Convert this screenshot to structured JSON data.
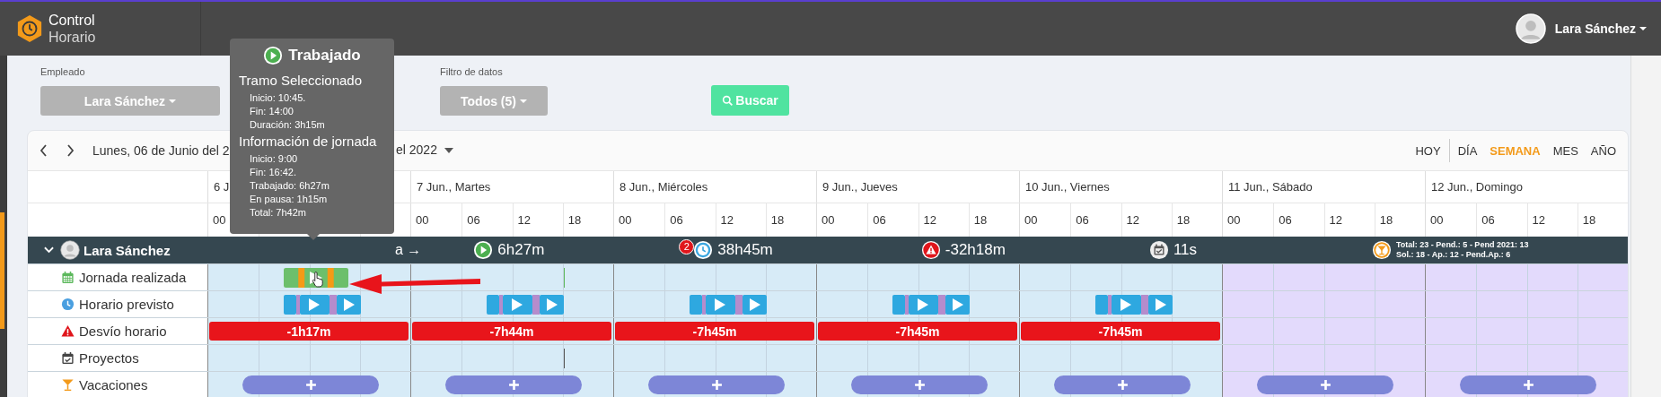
{
  "app": {
    "title_line_1": "Control",
    "title_line_2": "Horario"
  },
  "user": {
    "name": "Lara Sánchez"
  },
  "filters": [
    {
      "label": "Empleado",
      "value": "Lara Sánchez"
    },
    {
      "label": "Filtro de datos",
      "value": "Todos (5)"
    }
  ],
  "search_button": "Buscar",
  "toolbar": {
    "date_range_start": "Lunes, 06 de Junio del 2",
    "date_range_end": "el 2022",
    "views": [
      {
        "label": "HOY",
        "selected": false
      },
      {
        "label": "DÍA",
        "selected": false
      },
      {
        "label": "SEMANA",
        "selected": true
      },
      {
        "label": "MES",
        "selected": false
      },
      {
        "label": "AÑO",
        "selected": false
      }
    ]
  },
  "days": [
    {
      "label": "6 J",
      "kind": "weekday",
      "hours": [
        "00"
      ],
      "worked": true,
      "worked_tick": false,
      "planned": true,
      "deviation": "-1h17m",
      "project": false
    },
    {
      "label": "7 Jun., Martes",
      "kind": "weekday",
      "hours": [
        "00",
        "06",
        "12",
        "18"
      ],
      "worked": false,
      "worked_tick": true,
      "planned": true,
      "deviation": "-7h44m",
      "project": true
    },
    {
      "label": "8 Jun., Miércoles",
      "kind": "weekday",
      "hours": [
        "00",
        "06",
        "12",
        "18"
      ],
      "worked": false,
      "worked_tick": false,
      "planned": true,
      "deviation": "-7h45m",
      "project": false
    },
    {
      "label": "9 Jun., Jueves",
      "kind": "weekday",
      "hours": [
        "00",
        "06",
        "12",
        "18"
      ],
      "worked": false,
      "worked_tick": false,
      "planned": true,
      "deviation": "-7h45m",
      "project": false
    },
    {
      "label": "10 Jun., Viernes",
      "kind": "weekday",
      "hours": [
        "00",
        "06",
        "12",
        "18"
      ],
      "worked": false,
      "worked_tick": false,
      "planned": true,
      "deviation": "-7h45m",
      "project": false
    },
    {
      "label": "11 Jun., Sábado",
      "kind": "weekend",
      "hours": [
        "00",
        "06",
        "12",
        "18"
      ],
      "worked": false,
      "worked_tick": false,
      "planned": false,
      "project": false
    },
    {
      "label": "12 Jun., Domingo",
      "kind": "weekend",
      "hours": [
        "00",
        "06",
        "12",
        "18"
      ],
      "worked": false,
      "worked_tick": false,
      "planned": false,
      "project": false
    }
  ],
  "employee": {
    "name": "Lara Sánchez",
    "expanded": true,
    "summary": [
      {
        "kind": "text",
        "text": "a →"
      },
      {
        "kind": "worked",
        "text": "6h27m"
      },
      {
        "kind": "planned",
        "badge": "2",
        "text": "38h45m"
      },
      {
        "kind": "deviation",
        "text": "-32h18m"
      },
      {
        "kind": "projects",
        "text": "11s"
      },
      {
        "kind": "vacation",
        "lines": [
          "Total: 23 - Pend.: 5 - Pend 2021: 13",
          "Sol.: 18 - Ap.: 12 - Pend.Ap.: 6"
        ]
      }
    ]
  },
  "rows": [
    {
      "kind": "worked",
      "label": "Jornada realizada"
    },
    {
      "kind": "planned",
      "label": "Horario previsto"
    },
    {
      "kind": "deviation",
      "label": "Desvío horario"
    },
    {
      "kind": "projects",
      "label": "Proyectos"
    },
    {
      "kind": "vacation",
      "label": "Vacaciones"
    }
  ],
  "tooltip": {
    "title": "Trabajado",
    "sections": [
      {
        "heading": "Tramo Seleccionado",
        "lines": [
          "Inicio: 10:45.",
          "Fin: 14:00",
          "Duración: 3h15m"
        ]
      },
      {
        "heading": "Información de jornada",
        "lines": [
          "Inicio: 9:00",
          "Fin: 16:42.",
          "Trabajado: 6h27m",
          "En pausa: 1h15m",
          "Total: 7h42m"
        ]
      }
    ]
  }
}
